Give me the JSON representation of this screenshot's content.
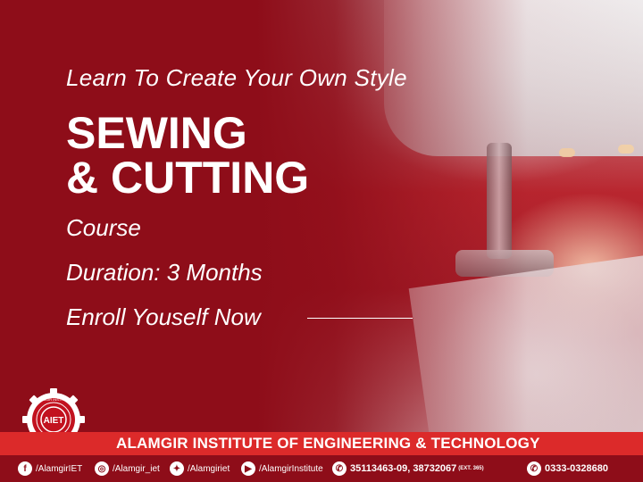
{
  "headline": {
    "tagline": "Learn To Create Your Own Style",
    "title_line1": "SEWING",
    "title_line2": "& CUTTING",
    "subtitle": "Course",
    "duration": "Duration: 3 Months",
    "cta": "Enroll Youself Now"
  },
  "logo": {
    "letters": "AIET",
    "ring_text": "ALAMGIR INSTITUTE",
    "icon": "gear-logo-icon"
  },
  "institute": {
    "name": "ALAMGIR INSTITUTE OF ENGINEERING & TECHNOLOGY"
  },
  "contacts": [
    {
      "icon": "facebook-icon",
      "glyph": "f",
      "text": "/AlamgirIET"
    },
    {
      "icon": "instagram-icon",
      "glyph": "◎",
      "text": "/Alamgir_iet"
    },
    {
      "icon": "twitter-icon",
      "glyph": "✦",
      "text": "/Alamgiriet"
    },
    {
      "icon": "youtube-icon",
      "glyph": "▶",
      "text": "/AlamgirInstitute"
    },
    {
      "icon": "phone-icon",
      "glyph": "✆",
      "text": "35113463-09, 38732067",
      "ext": "(EXT. 365)"
    },
    {
      "icon": "whatsapp-icon",
      "glyph": "✆",
      "text": "0333-0328680"
    }
  ],
  "colors": {
    "brand_red": "#8e0d19",
    "bar_red": "#dc2a2a",
    "text": "#ffffff"
  }
}
